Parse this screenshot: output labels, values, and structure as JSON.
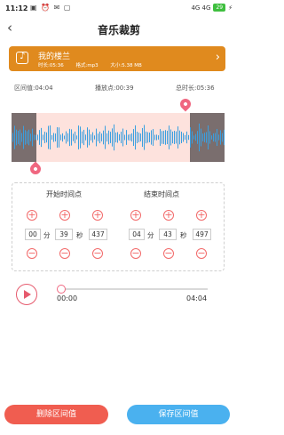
{
  "status_bar": {
    "time": "11:12",
    "network": "4G 4G",
    "battery": "29"
  },
  "header": {
    "back_icon": "‹",
    "title": "音乐裁剪"
  },
  "song": {
    "name": "我的楼兰",
    "duration": "时长:05:36",
    "format": "格式:mp3",
    "size": "大小:5.38 MB"
  },
  "info": {
    "range": "区间值:04:04",
    "position": "播放点:00:39",
    "total": "总时长:05:36"
  },
  "start_point": {
    "label": "开始时间点",
    "min": "00",
    "sec": "39",
    "ms": "437"
  },
  "end_point": {
    "label": "结束时间点",
    "min": "04",
    "sec": "43",
    "ms": "497"
  },
  "units": {
    "min": "分",
    "sec": "秒"
  },
  "player": {
    "current": "00:00",
    "end": "04:04",
    "progress": 0
  },
  "buttons": {
    "delete": "删除区间值",
    "save": "保存区间值"
  },
  "colors": {
    "accent": "#f06780",
    "card": "#e08a1e",
    "delete": "#f05d50",
    "save": "#4ab1ef"
  }
}
